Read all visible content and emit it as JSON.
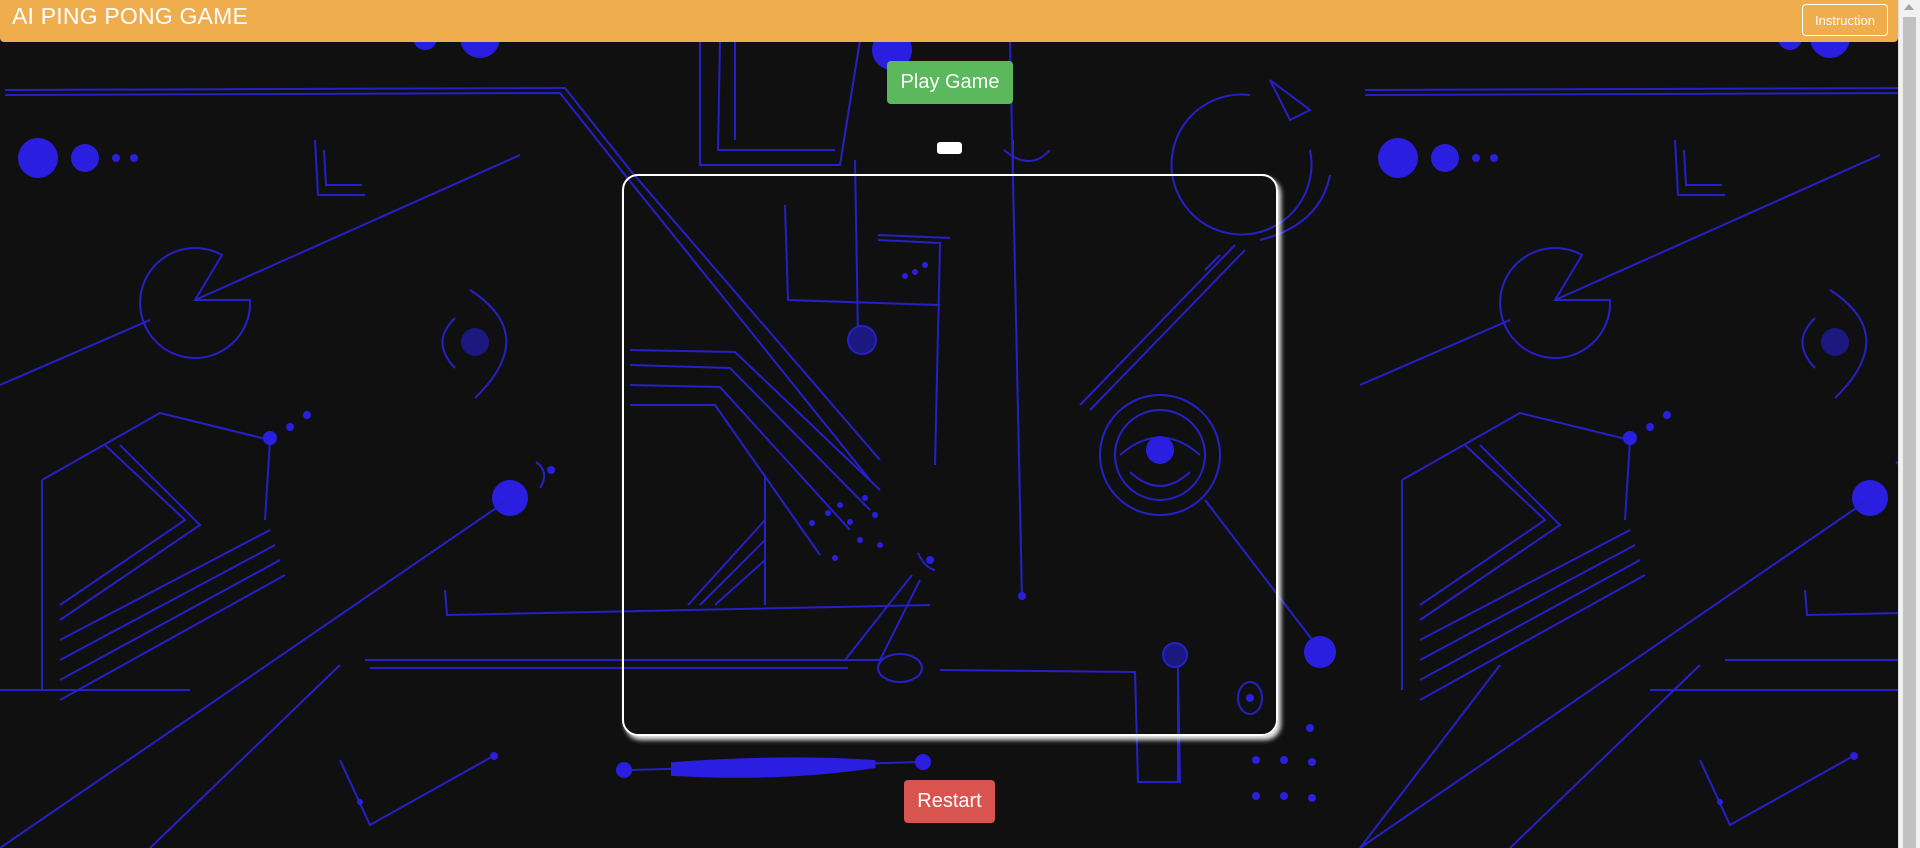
{
  "header": {
    "title": "AI PING PONG GAME",
    "instruction_label": "Instruction"
  },
  "controls": {
    "play_label": "Play Game",
    "restart_label": "Restart"
  },
  "game": {
    "board_border_color": "#ffffff",
    "paddle_color": "#ffffff"
  },
  "theme": {
    "header_color": "#f0ad4e",
    "play_button_color": "#5cb85c",
    "restart_button_color": "#d9534f",
    "background_color": "#101010",
    "circuit_color": "#2a22d8"
  }
}
